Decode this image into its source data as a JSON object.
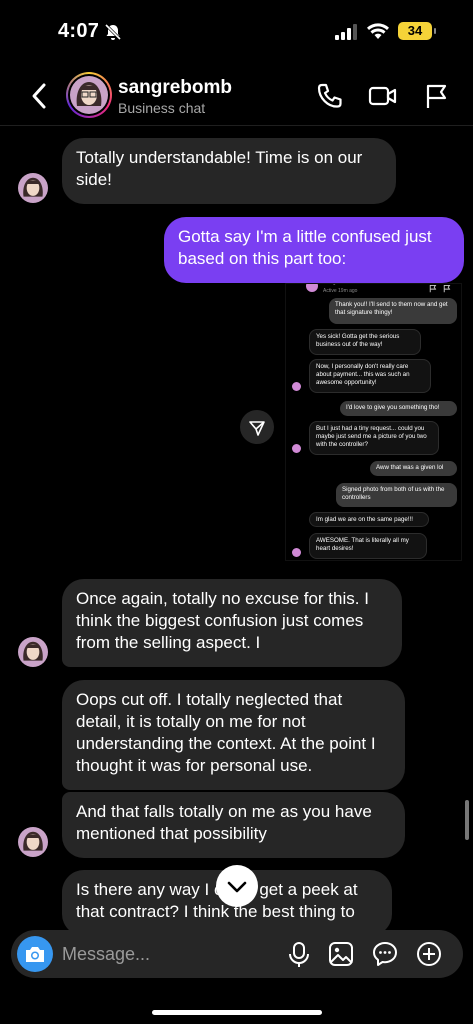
{
  "status_bar": {
    "time": "4:07",
    "battery": "34"
  },
  "header": {
    "username": "sangrebomb",
    "subtitle": "Business chat"
  },
  "messages": [
    {
      "from": "them",
      "text": "Totally understandable! Time is on our side!"
    },
    {
      "from": "me",
      "text": "Gotta say I'm a little confused just based on this part too:"
    },
    {
      "from": "them",
      "text": "Once again, totally no excuse for this. I think the biggest confusion just comes from the selling aspect. I"
    },
    {
      "from": "them",
      "text": "Oops cut off. I totally neglected that detail, it is totally on me for not understanding the context. At the point I thought it was for personal use."
    },
    {
      "from": "them",
      "text": "And that falls totally on me as you have mentioned that possibility"
    },
    {
      "from": "them",
      "text": "Is there any way I could get a peek at that contract? I think the best thing to"
    }
  ],
  "screenshot": {
    "header_name": "sangrebomb",
    "header_status": "Active 19m ago",
    "messages": [
      {
        "from": "me",
        "text": "Thank you!! I'll send to them now and get that signature thingy!"
      },
      {
        "from": "them",
        "text": "Yes sick! Gotta get the serious business out of the way!"
      },
      {
        "from": "them",
        "text": "Now, I personally don't really care about payment... this was such an awesome opportunity!"
      },
      {
        "from": "me",
        "text": "I'd love to give you something tho!"
      },
      {
        "from": "them",
        "text": "But I just had a tiny request... could you maybe just send me a picture of you two with the controller?"
      },
      {
        "from": "me",
        "text": "Aww that was a given lol"
      },
      {
        "from": "me",
        "text": "Signed photo from both of us with the controllers"
      },
      {
        "from": "them",
        "text": "Im glad we are on the same page!!!"
      },
      {
        "from": "them",
        "text": "AWESOME. That is literally all my heart desires!"
      }
    ]
  },
  "composer": {
    "placeholder": "Message..."
  },
  "icons": {
    "back": "chevron-left-icon",
    "call": "phone-icon",
    "video": "video-camera-icon",
    "report": "flag-icon",
    "camera": "camera-icon",
    "mic": "microphone-icon",
    "gallery": "image-icon",
    "sticker": "chat-bubble-icon",
    "add": "plus-circle-icon",
    "share": "send-icon",
    "scroll_down": "chevron-down-icon"
  },
  "colors": {
    "outgoing_bubble": "#7a3ff2",
    "incoming_bubble": "#262626",
    "camera_button": "#3797f0",
    "battery": "#f5d338"
  }
}
